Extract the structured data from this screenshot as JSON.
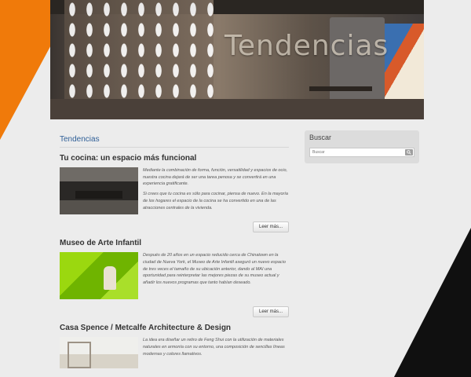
{
  "header": {
    "banner_title": "Tendencias"
  },
  "main": {
    "section_title": "Tendencias",
    "articles": [
      {
        "title": "Tu cocina: un espacio más funcional",
        "paragraphs": [
          "Mediante la combinación de forma, función, versatilidad y espacios de ocio, nuestra cocina dejará de ser una tarea penosa y se convertirá en una experiencia gratificante.",
          "Si crees que tu cocina es sólo para cocinar, piensa de nuevo. En la mayoría de los hogares el espacio de la cocina se ha convertido en una de las atracciones centrales de la vivienda."
        ],
        "read_more": "Leer más..."
      },
      {
        "title": "Museo de Arte Infantil",
        "paragraphs": [
          "Después de 20 años en un espacio reducido cerca de Chinatown en la ciudad de Nueva York, el Museo de Arte Infantil aseguró un nuevo espacio de tres veces el tamaño de su ubicación anterior, dando al MAI una oportunidad para reinterpretar las mejores piezas de su museo actual y añadir los nuevos programas que tanto habían deseado."
        ],
        "read_more": "Leer más..."
      },
      {
        "title": "Casa Spence / Metcalfe Architecture & Design",
        "paragraphs": [
          "La idea era diseñar un retiro de Feng Shui con la utilización de materiales naturales en armonía con su entorno, una composición de sencillas líneas modernas y colores llamativos."
        ]
      }
    ]
  },
  "sidebar": {
    "widget_title": "Buscar",
    "search_placeholder": "Buscar"
  },
  "colors": {
    "accent_orange": "#f07a0a",
    "link_blue": "#2f5f97",
    "deco_black": "#101010"
  }
}
